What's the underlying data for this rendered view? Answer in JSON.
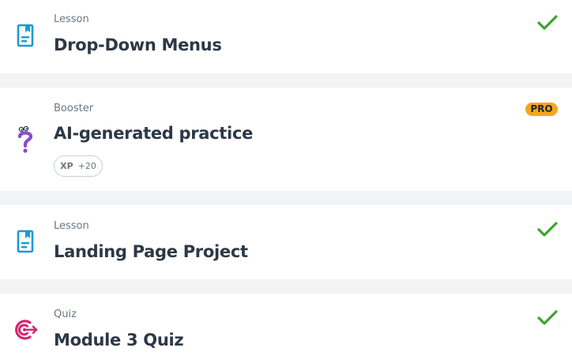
{
  "items": [
    {
      "category": "Lesson",
      "title": "Drop-Down Menus",
      "icon": "lesson-icon",
      "completed": true
    },
    {
      "category": "Booster",
      "title": "AI-generated practice",
      "icon": "booster-question-icon",
      "badge": "PRO",
      "xp_label": "XP",
      "xp_value": "+20"
    },
    {
      "category": "Lesson",
      "title": "Landing Page Project",
      "icon": "lesson-icon",
      "completed": true
    },
    {
      "category": "Quiz",
      "title": "Module 3 Quiz",
      "icon": "quiz-target-icon",
      "completed": true
    }
  ],
  "colors": {
    "background": "#f1f3f5",
    "card": "#ffffff",
    "lesson_icon": "#1c9ad6",
    "booster_icon": "#8a4bd1",
    "quiz_icon": "#d6256e",
    "check": "#3ba52d",
    "pro_badge": "#f7a51c"
  }
}
